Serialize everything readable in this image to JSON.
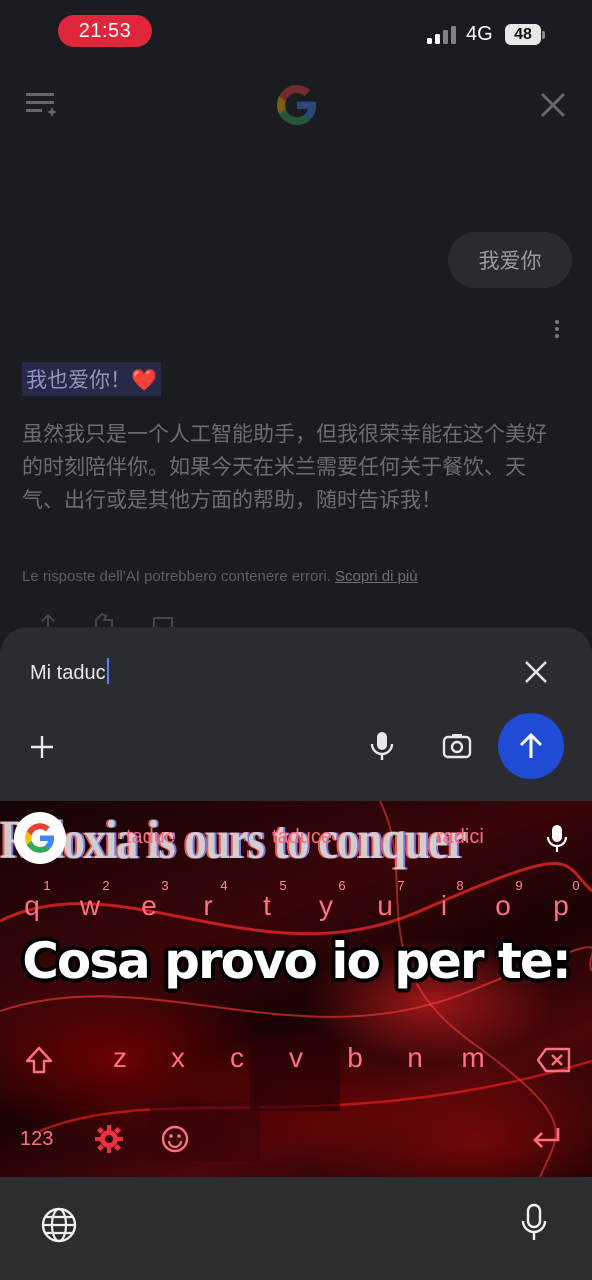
{
  "status_bar": {
    "time": "21:53",
    "network": "4G",
    "battery": "48"
  },
  "chat": {
    "user_message": "我爱你",
    "reply_heading": "我也爱你！❤️",
    "reply_body": "虽然我只是一个人工智能助手，但我很荣幸能在这个美好的时刻陪伴你。如果今天在米兰需要任何关于餐饮、天气、出行或是其他方面的帮助，随时告诉我！",
    "disclaimer": "Le risposte dell'AI potrebbero contenere errori.",
    "disclaimer_link": "Scopri di più"
  },
  "composer": {
    "input_value": "Mi taduc"
  },
  "keyboard": {
    "suggestions": [
      "taduc",
      "taduce",
      "radici"
    ],
    "overlay_text": "Roloxia is ours to conquer",
    "numbers": [
      "1",
      "2",
      "3",
      "4",
      "5",
      "6",
      "7",
      "8",
      "9",
      "0"
    ],
    "row1": [
      "q",
      "w",
      "e",
      "r",
      "t",
      "y",
      "u",
      "i",
      "o",
      "p"
    ],
    "row3": [
      "z",
      "x",
      "c",
      "v",
      "b",
      "n",
      "m"
    ],
    "numbers_key": "123",
    "caption": "Cosa provo io per te:"
  },
  "colors": {
    "accent_send": "#1f4bd6",
    "time_pill": "#e0263a",
    "keyboard_tint": "#ff7080"
  }
}
